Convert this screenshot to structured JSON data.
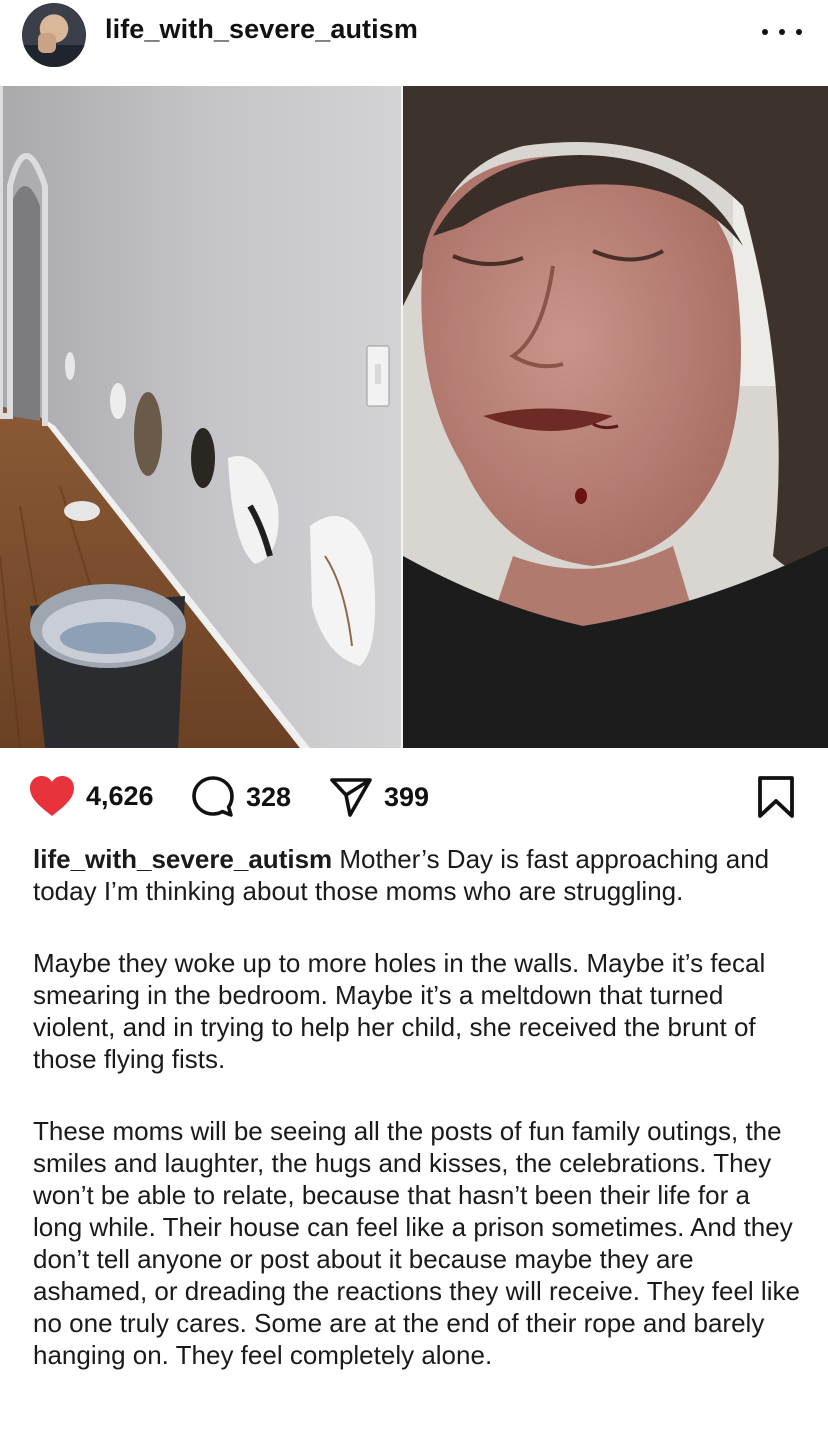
{
  "post": {
    "username": "life_with_severe_autism",
    "more_icon": "ellipsis-icon"
  },
  "actions": {
    "likes": "4,626",
    "comments": "328",
    "shares": "399",
    "like_color": "#e8333c"
  },
  "caption": {
    "username": "life_with_severe_autism",
    "paragraphs": [
      "Mother’s Day is fast approaching and today I’m thinking about those moms who are struggling.",
      "Maybe they woke up to more holes in the walls. Maybe it’s fecal smearing in the bedroom. Maybe it’s a meltdown that turned violent, and in trying to help her child, she received the brunt of those flying fists.",
      "These moms will be seeing all the posts of fun family outings, the smiles and laughter, the hugs and kisses, the celebrations. They won’t be able to relate, because that hasn’t been their life for a long while. Their house can feel like a prison sometimes. And they don’t tell anyone or post about it because maybe they are ashamed, or dreading the reactions they will receive. They feel like no one truly cares. Some are at the end of their rope and barely hanging on. They feel completely alone."
    ]
  }
}
